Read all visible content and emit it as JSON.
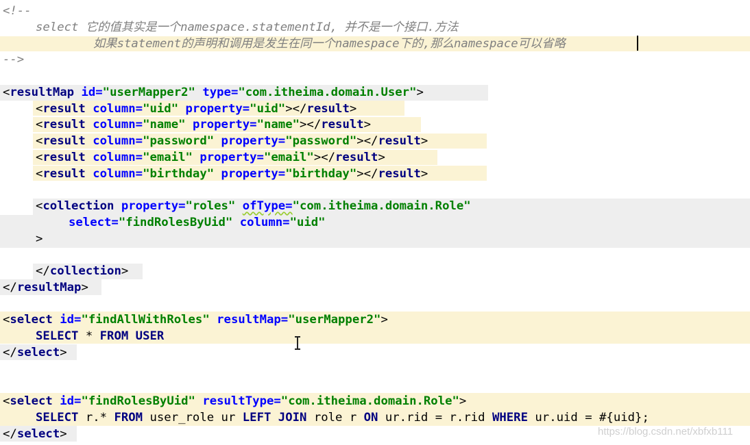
{
  "lines": [
    {
      "row": 0,
      "indent": 0,
      "tokens": [
        {
          "t": "<!--",
          "c": "comment"
        }
      ]
    },
    {
      "row": 1,
      "indent": 4,
      "tokens": [
        {
          "t": "select 它的值其实是一个namespace.statementId, 并不是一个接口.方法",
          "c": "comment"
        }
      ]
    },
    {
      "row": 2,
      "indent": 11,
      "tokens": [
        {
          "t": "如果statement的声明和调用是发生在同一个namespace下的,那么namespace可以省略",
          "c": "comment"
        }
      ]
    },
    {
      "row": 3,
      "indent": 0,
      "tokens": [
        {
          "t": "-->",
          "c": "comment"
        }
      ]
    },
    {
      "row": 5,
      "indent": 0,
      "tokens": [
        {
          "t": "<",
          "c": "plain"
        },
        {
          "t": "resultMap ",
          "c": "tag"
        },
        {
          "t": "id=",
          "c": "attr"
        },
        {
          "t": "\"userMapper2\" ",
          "c": "val"
        },
        {
          "t": "type=",
          "c": "attr"
        },
        {
          "t": "\"com.itheima.domain.User\"",
          "c": "val"
        },
        {
          "t": ">",
          "c": "plain"
        }
      ]
    },
    {
      "row": 6,
      "indent": 4,
      "tokens": [
        {
          "t": "<",
          "c": "plain"
        },
        {
          "t": "result ",
          "c": "tag"
        },
        {
          "t": "column=",
          "c": "attr"
        },
        {
          "t": "\"uid\" ",
          "c": "val"
        },
        {
          "t": "property=",
          "c": "attr"
        },
        {
          "t": "\"uid\"",
          "c": "val"
        },
        {
          "t": "></",
          "c": "plain"
        },
        {
          "t": "result",
          "c": "tag"
        },
        {
          "t": ">",
          "c": "plain"
        }
      ]
    },
    {
      "row": 7,
      "indent": 4,
      "tokens": [
        {
          "t": "<",
          "c": "plain"
        },
        {
          "t": "result ",
          "c": "tag"
        },
        {
          "t": "column=",
          "c": "attr"
        },
        {
          "t": "\"name\" ",
          "c": "val"
        },
        {
          "t": "property=",
          "c": "attr"
        },
        {
          "t": "\"name\"",
          "c": "val"
        },
        {
          "t": "></",
          "c": "plain"
        },
        {
          "t": "result",
          "c": "tag"
        },
        {
          "t": ">",
          "c": "plain"
        }
      ]
    },
    {
      "row": 8,
      "indent": 4,
      "tokens": [
        {
          "t": "<",
          "c": "plain"
        },
        {
          "t": "result ",
          "c": "tag"
        },
        {
          "t": "column=",
          "c": "attr"
        },
        {
          "t": "\"password\" ",
          "c": "val"
        },
        {
          "t": "property=",
          "c": "attr"
        },
        {
          "t": "\"password\"",
          "c": "val"
        },
        {
          "t": "></",
          "c": "plain"
        },
        {
          "t": "result",
          "c": "tag"
        },
        {
          "t": ">",
          "c": "plain"
        }
      ]
    },
    {
      "row": 9,
      "indent": 4,
      "tokens": [
        {
          "t": "<",
          "c": "plain"
        },
        {
          "t": "result ",
          "c": "tag"
        },
        {
          "t": "column=",
          "c": "attr"
        },
        {
          "t": "\"email\" ",
          "c": "val"
        },
        {
          "t": "property=",
          "c": "attr"
        },
        {
          "t": "\"email\"",
          "c": "val"
        },
        {
          "t": "></",
          "c": "plain"
        },
        {
          "t": "result",
          "c": "tag"
        },
        {
          "t": ">",
          "c": "plain"
        }
      ]
    },
    {
      "row": 10,
      "indent": 4,
      "tokens": [
        {
          "t": "<",
          "c": "plain"
        },
        {
          "t": "result ",
          "c": "tag"
        },
        {
          "t": "column=",
          "c": "attr"
        },
        {
          "t": "\"birthday\" ",
          "c": "val"
        },
        {
          "t": "property=",
          "c": "attr"
        },
        {
          "t": "\"birthday\"",
          "c": "val"
        },
        {
          "t": "></",
          "c": "plain"
        },
        {
          "t": "result",
          "c": "tag"
        },
        {
          "t": ">",
          "c": "plain"
        }
      ]
    },
    {
      "row": 12,
      "indent": 4,
      "tokens": [
        {
          "t": "<",
          "c": "plain"
        },
        {
          "t": "collection ",
          "c": "tag"
        },
        {
          "t": "property=",
          "c": "attr"
        },
        {
          "t": "\"roles\" ",
          "c": "val"
        },
        {
          "t": "ofType=",
          "c": "attr",
          "sq": true
        },
        {
          "t": "\"com.itheima.domain.Role\"",
          "c": "val"
        }
      ]
    },
    {
      "row": 13,
      "indent": 8,
      "tokens": [
        {
          "t": "select=",
          "c": "attr"
        },
        {
          "t": "\"findRolesByUid\" ",
          "c": "val"
        },
        {
          "t": "column=",
          "c": "attr"
        },
        {
          "t": "\"uid\"",
          "c": "val"
        }
      ]
    },
    {
      "row": 14,
      "indent": 4,
      "tokens": [
        {
          "t": ">",
          "c": "plain"
        }
      ]
    },
    {
      "row": 16,
      "indent": 4,
      "tokens": [
        {
          "t": "</",
          "c": "plain"
        },
        {
          "t": "collection",
          "c": "tag"
        },
        {
          "t": ">",
          "c": "plain"
        }
      ]
    },
    {
      "row": 17,
      "indent": 0,
      "tokens": [
        {
          "t": "</",
          "c": "plain"
        },
        {
          "t": "resultMap",
          "c": "tag"
        },
        {
          "t": ">",
          "c": "plain"
        }
      ]
    },
    {
      "row": 19,
      "indent": 0,
      "tokens": [
        {
          "t": "<",
          "c": "plain"
        },
        {
          "t": "select ",
          "c": "tag"
        },
        {
          "t": "id=",
          "c": "attr"
        },
        {
          "t": "\"findAllWithRoles\" ",
          "c": "val"
        },
        {
          "t": "resultMap=",
          "c": "attr"
        },
        {
          "t": "\"userMapper2\"",
          "c": "val"
        },
        {
          "t": ">",
          "c": "plain"
        }
      ]
    },
    {
      "row": 20,
      "indent": 4,
      "tokens": [
        {
          "t": "SELECT ",
          "c": "kw"
        },
        {
          "t": "* ",
          "c": "plain"
        },
        {
          "t": "FROM USER",
          "c": "kw"
        }
      ]
    },
    {
      "row": 21,
      "indent": 0,
      "tokens": [
        {
          "t": "</",
          "c": "plain"
        },
        {
          "t": "select",
          "c": "tag"
        },
        {
          "t": ">",
          "c": "plain"
        }
      ]
    },
    {
      "row": 24,
      "indent": 0,
      "tokens": [
        {
          "t": "<",
          "c": "plain"
        },
        {
          "t": "select ",
          "c": "tag"
        },
        {
          "t": "id=",
          "c": "attr"
        },
        {
          "t": "\"findRolesByUid\" ",
          "c": "val"
        },
        {
          "t": "resultType=",
          "c": "attr"
        },
        {
          "t": "\"com.itheima.domain.Role\"",
          "c": "val"
        },
        {
          "t": ">",
          "c": "plain"
        }
      ]
    },
    {
      "row": 25,
      "indent": 4,
      "tokens": [
        {
          "t": "SELECT ",
          "c": "kw"
        },
        {
          "t": "r.* ",
          "c": "plain"
        },
        {
          "t": "FROM ",
          "c": "kw"
        },
        {
          "t": "user_role ur ",
          "c": "plain"
        },
        {
          "t": "LEFT JOIN ",
          "c": "kw"
        },
        {
          "t": "role r ",
          "c": "plain"
        },
        {
          "t": "ON ",
          "c": "kw"
        },
        {
          "t": "ur.rid = r.rid ",
          "c": "plain"
        },
        {
          "t": "WHERE ",
          "c": "kw"
        },
        {
          "t": "ur.uid = #{uid};",
          "c": "plain"
        }
      ]
    },
    {
      "row": 26,
      "indent": 0,
      "tokens": [
        {
          "t": "</",
          "c": "plain"
        },
        {
          "t": "select",
          "c": "tag"
        },
        {
          "t": ">",
          "c": "plain"
        }
      ]
    }
  ],
  "watermark": "https://blog.csdn.net/xbfxb111"
}
